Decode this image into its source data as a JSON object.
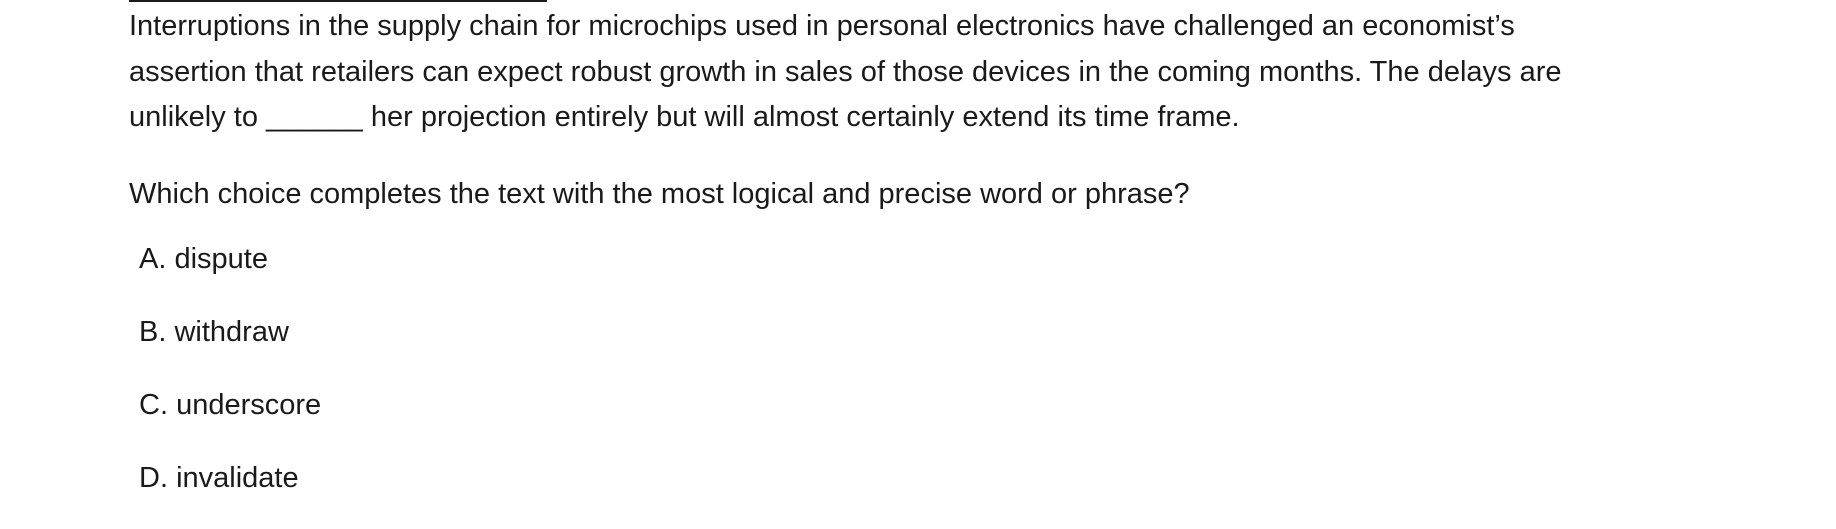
{
  "passage": {
    "line1": "Interruptions in the supply chain for microchips used in personal electronics have challenged an economist’s",
    "line2": "assertion that retailers can expect robust growth in sales of those devices in the coming months. The delays are",
    "line3": "unlikely to ______ her projection entirely but will almost certainly extend its time frame."
  },
  "question": "Which choice completes the text with the most logical and precise word or phrase?",
  "choices": [
    {
      "letter": "A.",
      "text": "dispute"
    },
    {
      "letter": "B.",
      "text": "withdraw"
    },
    {
      "letter": "C.",
      "text": "underscore"
    },
    {
      "letter": "D.",
      "text": "invalidate"
    }
  ]
}
